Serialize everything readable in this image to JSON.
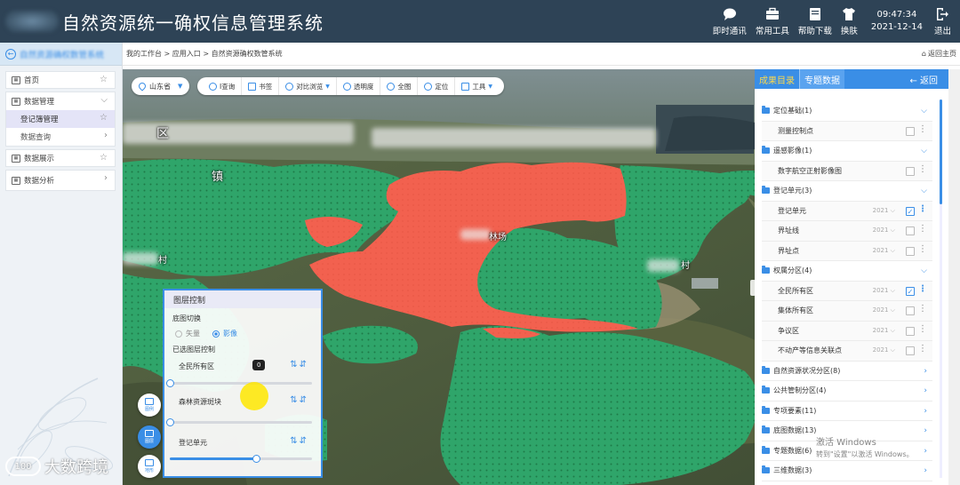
{
  "header": {
    "app_title": "自然资源统一确权信息管理系统",
    "tools": [
      {
        "label": "即时通讯",
        "icon": "chat-icon"
      },
      {
        "label": "常用工具",
        "icon": "toolbox-icon"
      },
      {
        "label": "帮助下载",
        "icon": "download-icon"
      },
      {
        "label": "换肤",
        "icon": "shirt-icon"
      }
    ],
    "time": "09:47:34",
    "date": "2021-12-14",
    "exit_label": "退出"
  },
  "sidebar": {
    "system_button": "自然资源确权数管系统",
    "items": [
      {
        "label": "首页",
        "right": "☆"
      },
      {
        "label": "数据管理",
        "right": "⌵"
      },
      {
        "label": "登记簿管理",
        "right": "☆",
        "sub": true,
        "active": true
      },
      {
        "label": "数据查询",
        "right": "›",
        "sub": true
      },
      {
        "label": "数据展示",
        "right": "☆"
      },
      {
        "label": "数据分析",
        "right": "›"
      }
    ]
  },
  "breadcrumb": {
    "path": "我的工作台 > 应用入口 > 自然资源确权数管系统",
    "back_label": "返回主页"
  },
  "map": {
    "region": "山东省",
    "tools": [
      "I查询",
      "书签",
      "对比浏览",
      "透明度",
      "全图",
      "定位",
      "工具"
    ],
    "labels": [
      "区",
      "镇",
      "林场",
      "村",
      "村"
    ],
    "layer_panel": {
      "title": "图层控制",
      "basemap_title": "底图切换",
      "basemap_options": [
        "矢量",
        "影像"
      ],
      "basemap_selected": "影像",
      "selected_layers_title": "已选图层控制",
      "order_icons": "⇅⇵",
      "layers": [
        {
          "name": "全民所有区",
          "opacity": 0
        },
        {
          "name": "森林资源斑块",
          "opacity": 0
        },
        {
          "name": "登记单元",
          "opacity": 0.6
        }
      ],
      "tooltip": "0"
    },
    "side_buttons": [
      {
        "label": "图例"
      },
      {
        "label": "图层"
      },
      {
        "label": "地形"
      }
    ],
    "watermark": "大数跨境",
    "activate_title": "激活 Windows",
    "activate_sub": "转到\"设置\"以激活 Windows。"
  },
  "right_panel": {
    "tabs": [
      "成果目录",
      "专题数据"
    ],
    "active_tab": "专题数据",
    "back_label": "返回",
    "rows": [
      {
        "type": "cat",
        "label": "定位基础(1)",
        "chev": "⌵"
      },
      {
        "type": "child",
        "label": "测量控制点",
        "year": "",
        "checked": false
      },
      {
        "type": "cat",
        "label": "遥感影像(1)",
        "chev": "⌵"
      },
      {
        "type": "child",
        "label": "数字航空正射影像图",
        "year": "",
        "checked": false
      },
      {
        "type": "cat",
        "label": "登记单元(3)",
        "chev": "⌵"
      },
      {
        "type": "child",
        "label": "登记单元",
        "year": "2021 ⌵",
        "checked": true
      },
      {
        "type": "child",
        "label": "界址线",
        "year": "2021 ⌵",
        "checked": false
      },
      {
        "type": "child",
        "label": "界址点",
        "year": "2021 ⌵",
        "checked": false
      },
      {
        "type": "cat",
        "label": "权属分区(4)",
        "chev": "⌵"
      },
      {
        "type": "child",
        "label": "全民所有区",
        "year": "2021 ⌵",
        "checked": true
      },
      {
        "type": "child",
        "label": "集体所有区",
        "year": "2021 ⌵",
        "checked": false
      },
      {
        "type": "child",
        "label": "争议区",
        "year": "2021 ⌵",
        "checked": false
      },
      {
        "type": "child",
        "label": "不动产等信息关联点",
        "year": "2021 ⌵",
        "checked": false
      },
      {
        "type": "cat",
        "label": "自然资源状况分区(8)",
        "chev": "›"
      },
      {
        "type": "cat",
        "label": "公共管制分区(4)",
        "chev": "›"
      },
      {
        "type": "cat",
        "label": "专项要素(11)",
        "chev": "›"
      },
      {
        "type": "cat",
        "label": "底图数据(13)",
        "chev": "›"
      },
      {
        "type": "cat",
        "label": "专题数据(6)",
        "chev": "›"
      },
      {
        "type": "cat",
        "label": "三维数据(3)",
        "chev": "›"
      }
    ]
  },
  "colors": {
    "header_bg": "#2e4356",
    "accent": "#3a8ee6",
    "tab_highlight": "#ffd94a",
    "state_owned_area": "#f2614f",
    "forest_patch": "#2fa56a"
  }
}
